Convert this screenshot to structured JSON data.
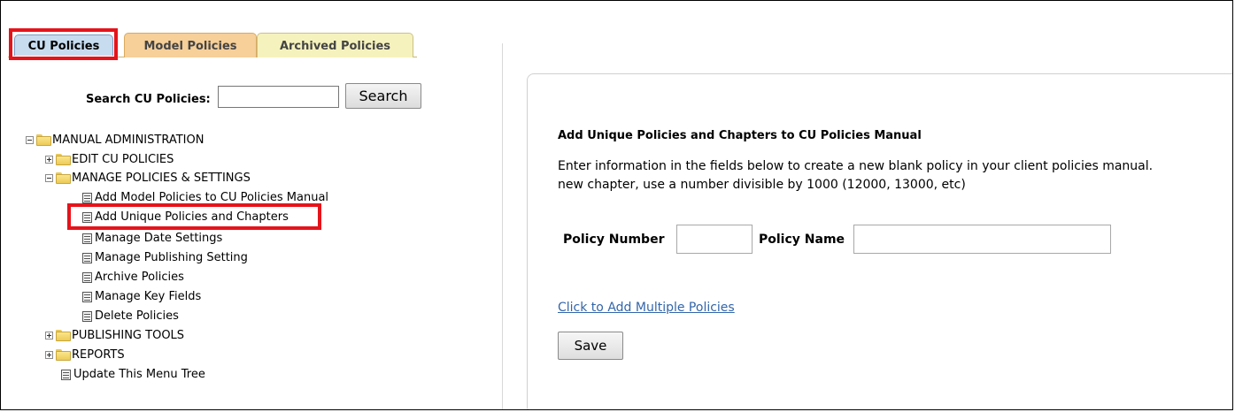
{
  "tabs": [
    {
      "label": "CU Policies",
      "active": true
    },
    {
      "label": "Model Policies",
      "active": false
    },
    {
      "label": "Archived Policies",
      "active": false
    }
  ],
  "search": {
    "label": "Search CU Policies:",
    "value": "",
    "button_label": "Search"
  },
  "tree": {
    "root": {
      "label": "MANUAL ADMINISTRATION",
      "expanded": true
    },
    "edit": {
      "label": "EDIT CU POLICIES",
      "expanded": false
    },
    "manage": {
      "label": "MANAGE POLICIES & SETTINGS",
      "expanded": true
    },
    "manage_items": [
      "Add Model Policies to CU Policies Manual",
      "Add Unique Policies and Chapters",
      "Manage Date Settings",
      "Manage Publishing Setting",
      "Archive Policies",
      "Manage Key Fields",
      "Delete Policies"
    ],
    "publishing": {
      "label": "PUBLISHING TOOLS",
      "expanded": false
    },
    "reports": {
      "label": "REPORTS",
      "expanded": false
    },
    "update": {
      "label": "Update This Menu Tree"
    }
  },
  "panel": {
    "heading": "Add Unique Policies and Chapters to CU Policies Manual",
    "description_line1": "Enter information in the fields below to create a new blank policy in your client policies manual.",
    "description_line2": "new chapter, use a number divisible by 1000 (12000, 13000, etc)",
    "policy_number_label": "Policy Number",
    "policy_number_value": "",
    "policy_name_label": "Policy Name",
    "policy_name_value": "",
    "multi_link": "Click to Add Multiple Policies",
    "save_label": "Save"
  },
  "colors": {
    "highlight": "#e5141b",
    "tab_active": "#c8dcf0",
    "tab_model": "#f6cf99",
    "tab_archived": "#f6f2bd",
    "link": "#3366aa"
  }
}
